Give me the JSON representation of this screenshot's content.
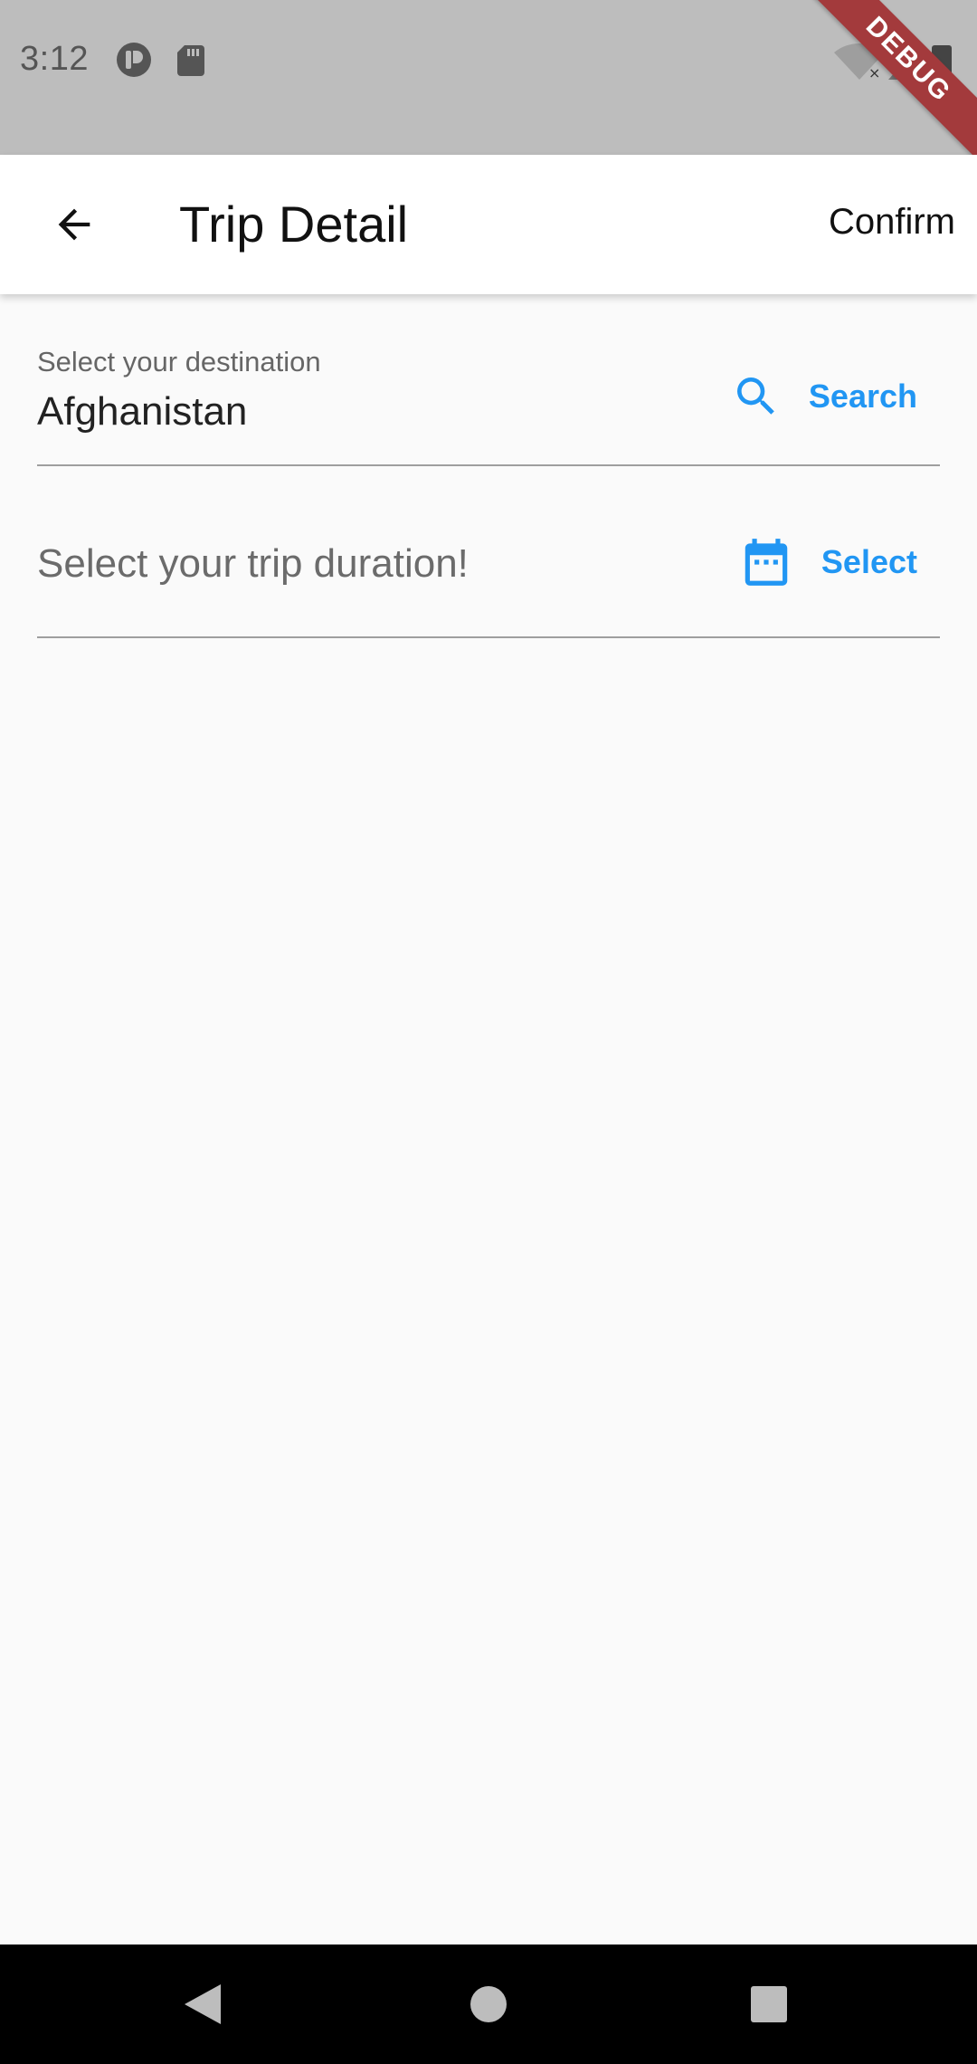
{
  "status_bar": {
    "time": "3:12",
    "icons_left": [
      "circle-p-icon",
      "sd-card-icon"
    ],
    "icons_right": [
      "wifi-off-icon",
      "signal-icon",
      "battery-icon"
    ],
    "debug_label": "DEBUG"
  },
  "app_bar": {
    "title": "Trip Detail",
    "confirm_label": "Confirm",
    "back_icon": "arrow-back-icon"
  },
  "destination_field": {
    "label": "Select your destination",
    "value": "Afghanistan",
    "action_label": "Search",
    "action_icon": "search-icon"
  },
  "duration_field": {
    "placeholder": "Select your trip duration!",
    "action_label": "Select",
    "action_icon": "calendar-icon"
  },
  "nav_bar": {
    "buttons": [
      "back-nav-icon",
      "home-nav-icon",
      "recents-nav-icon"
    ]
  },
  "colors": {
    "accent": "#2196f3",
    "status_bar": "#bdbdbd",
    "background": "#fafafa",
    "debug_banner": "#a33a3c"
  }
}
